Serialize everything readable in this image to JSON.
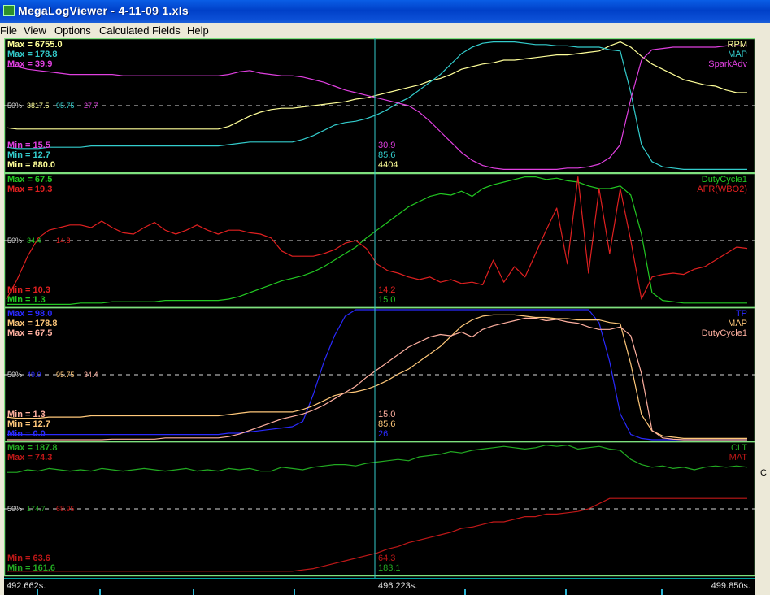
{
  "window": {
    "title": "MegaLogViewer - 4-11-09 1.xls",
    "icon": "app-icon"
  },
  "menu": [
    "File",
    "View",
    "Options",
    "Calculated Fields",
    "Help"
  ],
  "colors": {
    "rpm": "#ffff99",
    "map": "#33cccc",
    "spark": "#e040e0",
    "duty": "#22c822",
    "afr": "#e02020",
    "tp": "#2a2aff",
    "map2": "#ffc87a",
    "duty2": "#ffb0a0",
    "clt": "#22aa22",
    "mat": "#c01818",
    "border": "#7ee07e",
    "cursor": "#33cccc"
  },
  "panels": [
    {
      "maxes": [
        {
          "text": "Max = 6755.0",
          "color": "#ffff99"
        },
        {
          "text": "Max = 178.8",
          "color": "#33cccc"
        },
        {
          "text": "Max = 39.9",
          "color": "#e040e0"
        }
      ],
      "mins": [
        {
          "text": "Min = 15.5",
          "color": "#e040e0"
        },
        {
          "text": "Min = 12.7",
          "color": "#33cccc"
        },
        {
          "text": "Min = 880.0",
          "color": "#ffff99"
        }
      ],
      "legend": [
        {
          "text": "RPM",
          "color": "#ffff99"
        },
        {
          "text": "MAP",
          "color": "#33cccc"
        },
        {
          "text": "SparkAdv",
          "color": "#e040e0"
        }
      ],
      "mid": [
        {
          "text": "50%",
          "color": "#dddddd"
        },
        {
          "text": "3817.5",
          "color": "#ffff99"
        },
        {
          "text": "95.75",
          "color": "#33cccc"
        },
        {
          "text": "27.7",
          "color": "#e040e0"
        }
      ],
      "cursor_values": [
        {
          "text": "30.9",
          "color": "#e040e0"
        },
        {
          "text": "85.6",
          "color": "#33cccc"
        },
        {
          "text": "4404",
          "color": "#ffff99"
        }
      ]
    },
    {
      "maxes": [
        {
          "text": "Max = 67.5",
          "color": "#22c822"
        },
        {
          "text": "Max = 19.3",
          "color": "#e02020"
        }
      ],
      "mins": [
        {
          "text": "Min = 10.3",
          "color": "#e02020"
        },
        {
          "text": "Min = 1.3",
          "color": "#22c822"
        }
      ],
      "legend": [
        {
          "text": "DutyCycle1",
          "color": "#22c822"
        },
        {
          "text": "AFR(WBO2)",
          "color": "#e02020"
        }
      ],
      "mid": [
        {
          "text": "50%",
          "color": "#dddddd"
        },
        {
          "text": "34.4",
          "color": "#22c822"
        },
        {
          "text": "14.8",
          "color": "#e02020"
        }
      ],
      "cursor_values": [
        {
          "text": "14.2",
          "color": "#e02020"
        },
        {
          "text": "15.0",
          "color": "#22c822"
        }
      ]
    },
    {
      "maxes": [
        {
          "text": "Max = 98.0",
          "color": "#2a2aff"
        },
        {
          "text": "Max = 178.8",
          "color": "#ffc87a"
        },
        {
          "text": "Max = 67.5",
          "color": "#ffb0a0"
        }
      ],
      "mins": [
        {
          "text": "Min = 1.3",
          "color": "#ffb0a0"
        },
        {
          "text": "Min = 12.7",
          "color": "#ffc87a"
        },
        {
          "text": "Min = 0.0",
          "color": "#2a2aff"
        }
      ],
      "legend": [
        {
          "text": "TP",
          "color": "#2a2aff"
        },
        {
          "text": "MAP",
          "color": "#ffc87a"
        },
        {
          "text": "DutyCycle1",
          "color": "#ffb0a0"
        }
      ],
      "mid": [
        {
          "text": "50%",
          "color": "#dddddd"
        },
        {
          "text": "49.0",
          "color": "#2a2aff"
        },
        {
          "text": "95.75",
          "color": "#ffc87a"
        },
        {
          "text": "34.4",
          "color": "#ffb0a0"
        }
      ],
      "cursor_values": [
        {
          "text": "15.0",
          "color": "#ffb0a0"
        },
        {
          "text": "85.6",
          "color": "#ffc87a"
        },
        {
          "text": "26",
          "color": "#2a2aff"
        }
      ]
    },
    {
      "maxes": [
        {
          "text": "Max = 187.8",
          "color": "#22aa22"
        },
        {
          "text": "Max = 74.3",
          "color": "#c01818"
        }
      ],
      "mins": [
        {
          "text": "Min = 63.6",
          "color": "#c01818"
        },
        {
          "text": "Min = 161.6",
          "color": "#22aa22"
        }
      ],
      "legend": [
        {
          "text": "CLT",
          "color": "#22aa22"
        },
        {
          "text": "MAT",
          "color": "#c01818"
        }
      ],
      "mid": [
        {
          "text": "50%",
          "color": "#dddddd"
        },
        {
          "text": "174.7",
          "color": "#22aa22"
        },
        {
          "text": "68.95",
          "color": "#c01818"
        }
      ],
      "cursor_values": [
        {
          "text": "64.3",
          "color": "#c01818"
        },
        {
          "text": "183.1",
          "color": "#22aa22"
        }
      ]
    }
  ],
  "time_axis": {
    "start": "492.662s.",
    "cursor": "496.223s.",
    "end": "499.850s."
  },
  "right_edge_char": "C",
  "chart_data": [
    {
      "type": "line",
      "x_range": [
        492.662,
        499.85
      ],
      "cursor_time": 496.223,
      "series": [
        {
          "name": "RPM",
          "range": [
            880.0,
            6755.0
          ],
          "fractions": [
            0.33,
            0.32,
            0.32,
            0.32,
            0.32,
            0.32,
            0.32,
            0.32,
            0.32,
            0.32,
            0.32,
            0.32,
            0.32,
            0.32,
            0.32,
            0.32,
            0.32,
            0.32,
            0.32,
            0.32,
            0.32,
            0.34,
            0.38,
            0.42,
            0.45,
            0.47,
            0.48,
            0.48,
            0.49,
            0.5,
            0.51,
            0.52,
            0.53,
            0.55,
            0.56,
            0.58,
            0.6,
            0.62,
            0.64,
            0.66,
            0.69,
            0.71,
            0.74,
            0.78,
            0.8,
            0.82,
            0.83,
            0.85,
            0.85,
            0.86,
            0.87,
            0.88,
            0.89,
            0.89,
            0.9,
            0.91,
            0.92,
            0.96,
            0.99,
            0.95,
            0.88,
            0.82,
            0.78,
            0.74,
            0.7,
            0.68,
            0.66,
            0.65,
            0.62,
            0.6,
            0.6
          ]
        },
        {
          "name": "MAP",
          "range": [
            12.7,
            178.8
          ],
          "fractions": [
            0.18,
            0.17,
            0.17,
            0.17,
            0.18,
            0.18,
            0.18,
            0.18,
            0.19,
            0.19,
            0.19,
            0.19,
            0.19,
            0.19,
            0.19,
            0.19,
            0.19,
            0.19,
            0.19,
            0.19,
            0.19,
            0.2,
            0.21,
            0.22,
            0.22,
            0.22,
            0.22,
            0.22,
            0.24,
            0.27,
            0.31,
            0.35,
            0.37,
            0.38,
            0.4,
            0.43,
            0.47,
            0.52,
            0.56,
            0.62,
            0.68,
            0.74,
            0.82,
            0.9,
            0.95,
            0.98,
            0.99,
            0.99,
            0.99,
            0.98,
            0.97,
            0.97,
            0.96,
            0.96,
            0.95,
            0.95,
            0.95,
            0.93,
            0.92,
            0.6,
            0.2,
            0.07,
            0.03,
            0.02,
            0.01,
            0.01,
            0.01,
            0.01,
            0.01,
            0.01,
            0.01
          ]
        },
        {
          "name": "SparkAdv",
          "range": [
            15.5,
            39.9
          ],
          "fractions": [
            0.8,
            0.8,
            0.78,
            0.77,
            0.76,
            0.75,
            0.74,
            0.74,
            0.74,
            0.74,
            0.74,
            0.73,
            0.73,
            0.73,
            0.73,
            0.73,
            0.73,
            0.73,
            0.73,
            0.73,
            0.73,
            0.74,
            0.76,
            0.77,
            0.75,
            0.74,
            0.73,
            0.73,
            0.72,
            0.7,
            0.68,
            0.65,
            0.62,
            0.6,
            0.58,
            0.56,
            0.54,
            0.52,
            0.5,
            0.45,
            0.38,
            0.3,
            0.22,
            0.14,
            0.08,
            0.04,
            0.02,
            0.01,
            0.01,
            0.01,
            0.01,
            0.01,
            0.01,
            0.02,
            0.02,
            0.03,
            0.05,
            0.1,
            0.2,
            0.55,
            0.85,
            0.93,
            0.94,
            0.95,
            0.95,
            0.95,
            0.95,
            0.95,
            0.96,
            0.96,
            0.96
          ]
        },
        {
          "name": "DutyCycle1",
          "range": [
            1.3,
            67.5
          ],
          "fractions": [
            0.01,
            0.01,
            0.01,
            0.01,
            0.01,
            0.01,
            0.01,
            0.02,
            0.02,
            0.02,
            0.03,
            0.03,
            0.03,
            0.03,
            0.03,
            0.04,
            0.04,
            0.04,
            0.04,
            0.04,
            0.04,
            0.05,
            0.07,
            0.1,
            0.13,
            0.16,
            0.19,
            0.21,
            0.23,
            0.26,
            0.3,
            0.35,
            0.4,
            0.45,
            0.52,
            0.58,
            0.64,
            0.7,
            0.76,
            0.8,
            0.84,
            0.86,
            0.85,
            0.88,
            0.84,
            0.9,
            0.93,
            0.95,
            0.97,
            0.99,
            0.99,
            0.97,
            0.98,
            0.96,
            0.95,
            0.92,
            0.9,
            0.9,
            0.92,
            0.85,
            0.55,
            0.1,
            0.04,
            0.03,
            0.02,
            0.02,
            0.02,
            0.02,
            0.02,
            0.02,
            0.02
          ]
        },
        {
          "name": "AFR(WBO2)",
          "range": [
            10.3,
            19.3
          ],
          "fractions": [
            0.05,
            0.2,
            0.38,
            0.52,
            0.58,
            0.6,
            0.62,
            0.62,
            0.6,
            0.65,
            0.6,
            0.56,
            0.55,
            0.6,
            0.64,
            0.58,
            0.55,
            0.58,
            0.62,
            0.58,
            0.55,
            0.58,
            0.58,
            0.56,
            0.55,
            0.52,
            0.42,
            0.38,
            0.38,
            0.38,
            0.4,
            0.43,
            0.48,
            0.5,
            0.44,
            0.32,
            0.27,
            0.25,
            0.22,
            0.2,
            0.22,
            0.18,
            0.2,
            0.17,
            0.18,
            0.16,
            0.35,
            0.18,
            0.3,
            0.22,
            0.4,
            0.58,
            0.75,
            0.32,
            0.99,
            0.25,
            0.9,
            0.4,
            0.9,
            0.5,
            0.05,
            0.22,
            0.24,
            0.25,
            0.24,
            0.28,
            0.3,
            0.35,
            0.4,
            0.45,
            0.44
          ]
        },
        {
          "name": "TP",
          "range": [
            0.0,
            98.0
          ],
          "fractions": [
            0.04,
            0.04,
            0.04,
            0.04,
            0.04,
            0.04,
            0.04,
            0.04,
            0.04,
            0.04,
            0.04,
            0.04,
            0.04,
            0.04,
            0.04,
            0.04,
            0.04,
            0.04,
            0.04,
            0.04,
            0.04,
            0.05,
            0.05,
            0.06,
            0.07,
            0.08,
            0.09,
            0.1,
            0.14,
            0.35,
            0.6,
            0.8,
            0.95,
            1.0,
            1.0,
            1.0,
            1.0,
            1.0,
            1.0,
            1.0,
            1.0,
            1.0,
            1.0,
            1.0,
            1.0,
            1.0,
            1.0,
            1.0,
            1.0,
            1.0,
            1.0,
            1.0,
            1.0,
            1.0,
            1.0,
            1.0,
            0.9,
            0.6,
            0.2,
            0.04,
            0.01,
            0.0,
            0.0,
            0.0,
            0.0,
            0.0,
            0.0,
            0.0,
            0.0,
            0.0,
            0.0
          ]
        },
        {
          "name": "CLT",
          "range": [
            161.6,
            187.8
          ],
          "fractions": [
            0.78,
            0.78,
            0.8,
            0.79,
            0.81,
            0.8,
            0.79,
            0.8,
            0.79,
            0.81,
            0.8,
            0.79,
            0.8,
            0.81,
            0.8,
            0.79,
            0.8,
            0.81,
            0.79,
            0.8,
            0.79,
            0.81,
            0.8,
            0.81,
            0.79,
            0.79,
            0.82,
            0.81,
            0.8,
            0.82,
            0.83,
            0.84,
            0.84,
            0.83,
            0.85,
            0.86,
            0.87,
            0.88,
            0.87,
            0.9,
            0.91,
            0.92,
            0.94,
            0.93,
            0.95,
            0.96,
            0.97,
            0.98,
            0.97,
            0.96,
            0.97,
            0.99,
            0.98,
            0.99,
            0.96,
            0.97,
            0.98,
            0.96,
            0.95,
            0.88,
            0.84,
            0.82,
            0.83,
            0.81,
            0.82,
            0.8,
            0.82,
            0.83,
            0.82,
            0.83,
            0.82
          ]
        },
        {
          "name": "MAT",
          "range": [
            63.6,
            74.3
          ],
          "fractions": [
            0.02,
            0.02,
            0.02,
            0.02,
            0.02,
            0.02,
            0.02,
            0.02,
            0.02,
            0.02,
            0.02,
            0.02,
            0.02,
            0.02,
            0.02,
            0.02,
            0.02,
            0.02,
            0.02,
            0.02,
            0.02,
            0.02,
            0.02,
            0.02,
            0.02,
            0.02,
            0.02,
            0.02,
            0.03,
            0.04,
            0.06,
            0.08,
            0.1,
            0.12,
            0.14,
            0.16,
            0.19,
            0.21,
            0.24,
            0.26,
            0.28,
            0.3,
            0.32,
            0.35,
            0.36,
            0.38,
            0.4,
            0.4,
            0.42,
            0.44,
            0.44,
            0.46,
            0.46,
            0.47,
            0.48,
            0.5,
            0.54,
            0.58,
            0.58,
            0.58,
            0.58,
            0.58,
            0.58,
            0.58,
            0.58,
            0.58,
            0.58,
            0.58,
            0.58,
            0.58,
            0.58
          ]
        }
      ]
    }
  ]
}
